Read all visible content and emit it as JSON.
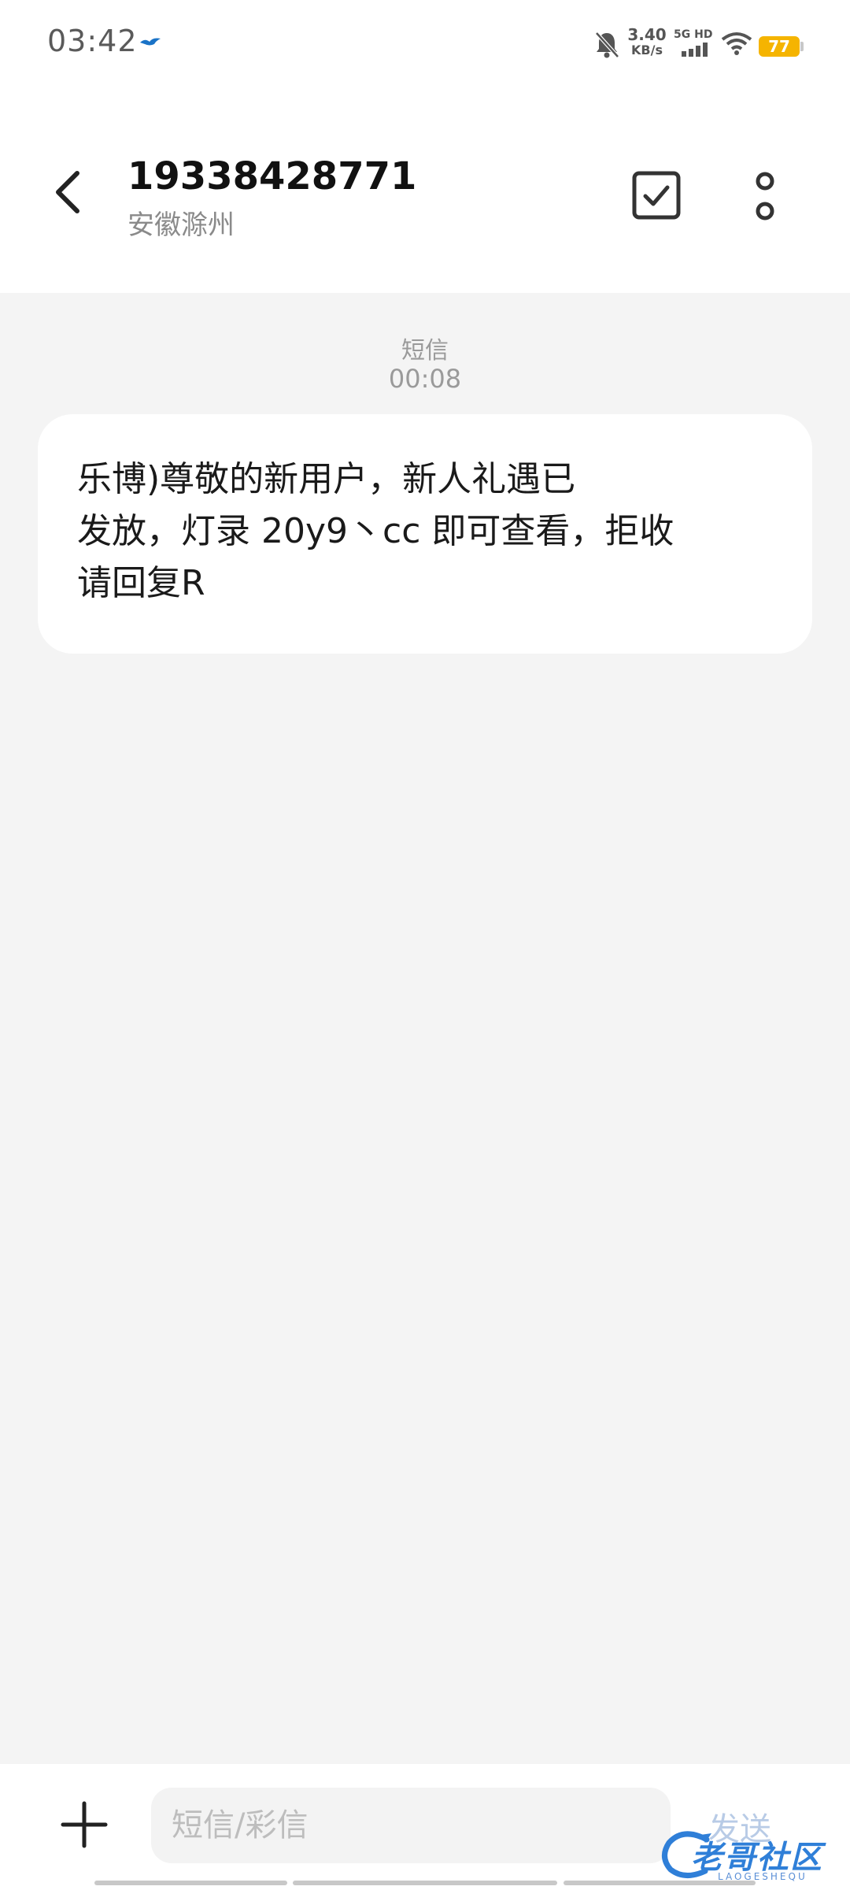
{
  "status_bar": {
    "time": "03:42",
    "speed_value": "3.40",
    "speed_unit": "KB/s",
    "network": "5G HD",
    "battery": "77",
    "battery_color": "#f5b400"
  },
  "header": {
    "contact_number": "19338428771",
    "contact_location": "安徽滁州",
    "icons": [
      "back-arrow-icon",
      "checkbox-icon",
      "more-vertical-icon"
    ]
  },
  "conversation": {
    "message_type": "短信",
    "message_time": "00:08",
    "messages": [
      {
        "text": "乐博)尊敬的新用户，新人礼遇已\n发放，灯录  20y9丶cc   即可查看，拒收\n请回复R"
      }
    ]
  },
  "composer": {
    "placeholder": "短信/彩信",
    "send_label": "发送",
    "accent_color": "#2f7fd8"
  },
  "watermark": {
    "text": "老哥社区",
    "sub": "LAOGESHEQU"
  }
}
